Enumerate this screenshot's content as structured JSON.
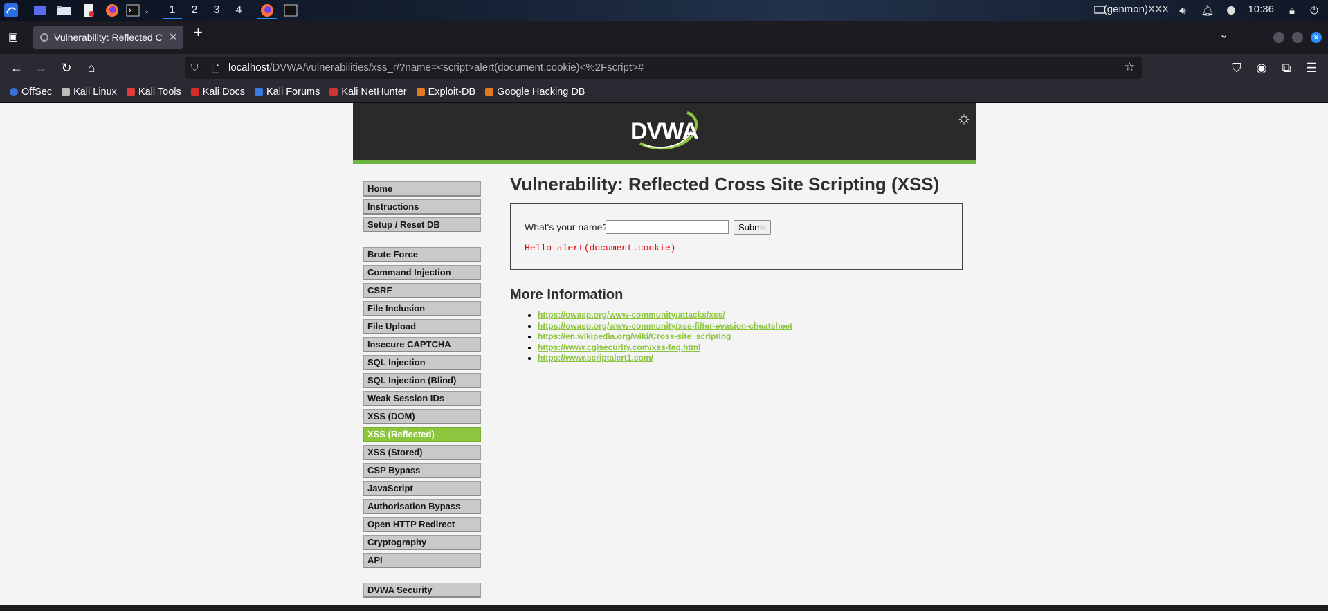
{
  "taskbar": {
    "workspaces": [
      "1",
      "2",
      "3",
      "4"
    ],
    "active_workspace": "1",
    "user": "(genmon)XXX",
    "clock": "10:36"
  },
  "browser": {
    "tab_title": "Vulnerability: Reflected C",
    "url_host": "localhost",
    "url_path": "/DVWA/vulnerabilities/xss_r/?name=<script>alert(document.cookie)<%2Fscript>#",
    "bookmarks": [
      "OffSec",
      "Kali Linux",
      "Kali Tools",
      "Kali Docs",
      "Kali Forums",
      "Kali NetHunter",
      "Exploit-DB",
      "Google Hacking DB"
    ]
  },
  "dvwa": {
    "logo": "DVWA",
    "menu_group1": [
      "Home",
      "Instructions",
      "Setup / Reset DB"
    ],
    "menu_group2": [
      "Brute Force",
      "Command Injection",
      "CSRF",
      "File Inclusion",
      "File Upload",
      "Insecure CAPTCHA",
      "SQL Injection",
      "SQL Injection (Blind)",
      "Weak Session IDs",
      "XSS (DOM)",
      "XSS (Reflected)",
      "XSS (Stored)",
      "CSP Bypass",
      "JavaScript",
      "Authorisation Bypass",
      "Open HTTP Redirect",
      "Cryptography",
      "API"
    ],
    "menu_group3": [
      "DVWA Security"
    ],
    "selected_item": "XSS (Reflected)",
    "title": "Vulnerability: Reflected Cross Site Scripting (XSS)",
    "question": "What's your name?",
    "input_value": "",
    "submit_label": "Submit",
    "output": "Hello alert(document.cookie)",
    "more_info_heading": "More Information",
    "links": [
      "https://owasp.org/www-community/attacks/xss/",
      "https://owasp.org/www-community/xss-filter-evasion-cheatsheet",
      "https://en.wikipedia.org/wiki/Cross-site_scripting",
      "https://www.cgisecurity.com/xss-faq.html",
      "https://www.scriptalert1.com/"
    ]
  },
  "colors": {
    "accent_green": "#8cc63f",
    "header_dark": "#2a2a2a",
    "error_red": "#e00000"
  }
}
